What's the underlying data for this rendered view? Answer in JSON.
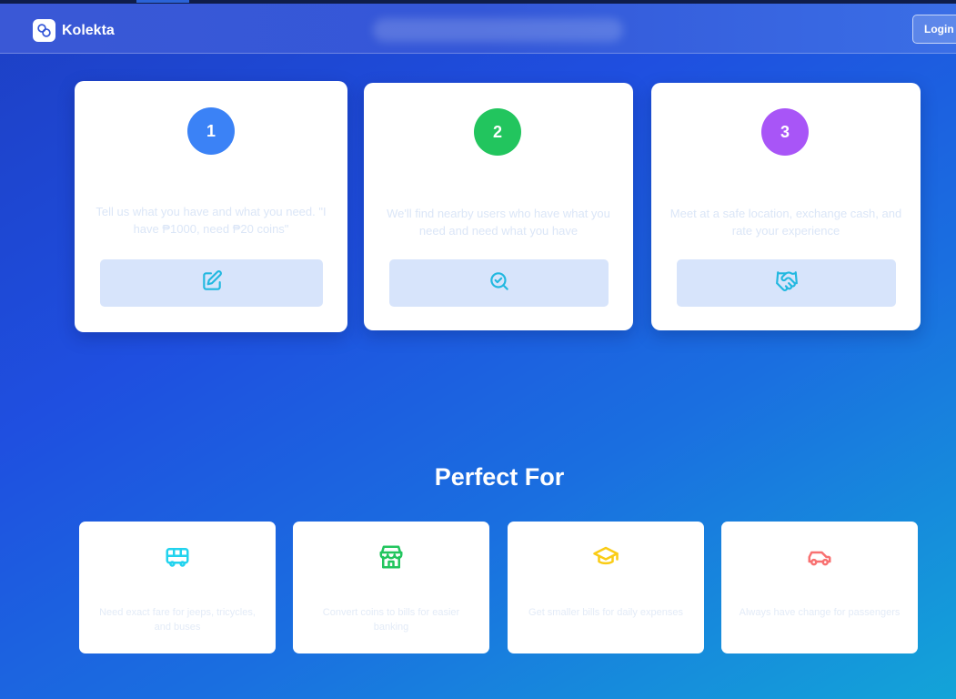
{
  "header": {
    "brand": "Kolekta",
    "login_label": "Login"
  },
  "steps": [
    {
      "number": "1",
      "description": "Tell us what you have and what you need. \"I have ₱1000, need ₱20 coins\"",
      "icon": "edit-icon",
      "color": "#3b82f6"
    },
    {
      "number": "2",
      "description": "We'll find nearby users who have what you need and need what you have",
      "icon": "search-check-icon",
      "color": "#22c55e"
    },
    {
      "number": "3",
      "description": "Meet at a safe location, exchange cash, and rate your experience",
      "icon": "handshake-icon",
      "color": "#a855f7"
    }
  ],
  "perfect_for": {
    "title": "Perfect For",
    "items": [
      {
        "description": "Need exact fare for jeeps, tricycles, and buses",
        "icon": "bus-icon",
        "color": "#22d3ee"
      },
      {
        "description": "Convert coins to bills for easier banking",
        "icon": "store-icon",
        "color": "#22c55e"
      },
      {
        "description": "Get smaller bills for daily expenses",
        "icon": "graduation-cap-icon",
        "color": "#facc15"
      },
      {
        "description": "Always have change for passengers",
        "icon": "car-icon",
        "color": "#f87171"
      }
    ]
  },
  "colors": {
    "action_icon": "#22b8e0",
    "action_bg": "#d7e4fb"
  }
}
